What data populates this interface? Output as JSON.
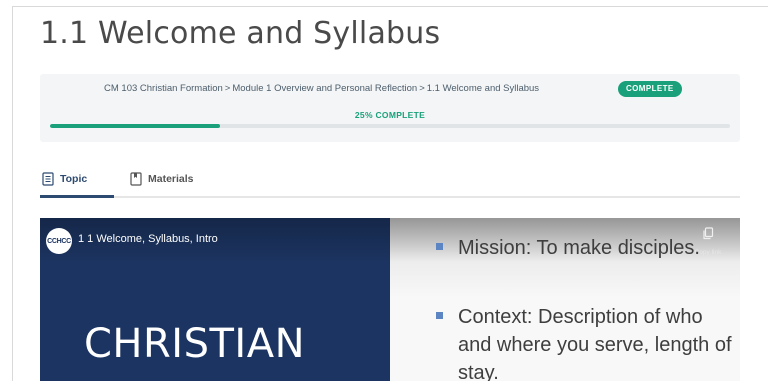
{
  "page": {
    "title": "1.1 Welcome and Syllabus"
  },
  "progress": {
    "breadcrumb": [
      "CM 103 Christian Formation",
      "Module 1 Overview and Personal Reflection",
      "1.1 Welcome and Syllabus"
    ],
    "breadcrumb_separator": ">",
    "status_badge": "COMPLETE",
    "percent_label": "25% COMPLETE",
    "percent": 25
  },
  "tabs": [
    {
      "label": "Topic",
      "icon": "document-icon",
      "active": true
    },
    {
      "label": "Materials",
      "icon": "bookmark-icon",
      "active": false
    }
  ],
  "video": {
    "channel_logo_text": "CCHCC",
    "title": "1 1 Welcome, Syllabus, Intro",
    "copy_link_label": "Copy link",
    "slide_heading": "CHRISTIAN",
    "slide_bullets": [
      "Mission: To make disciples.",
      "Context: Description of who and where you serve, length of stay."
    ]
  },
  "colors": {
    "accent_green": "#1aa07a",
    "tab_active": "#2d4a70",
    "slide_navy": "#1c3461",
    "bullet_blue": "#5b86c3"
  }
}
